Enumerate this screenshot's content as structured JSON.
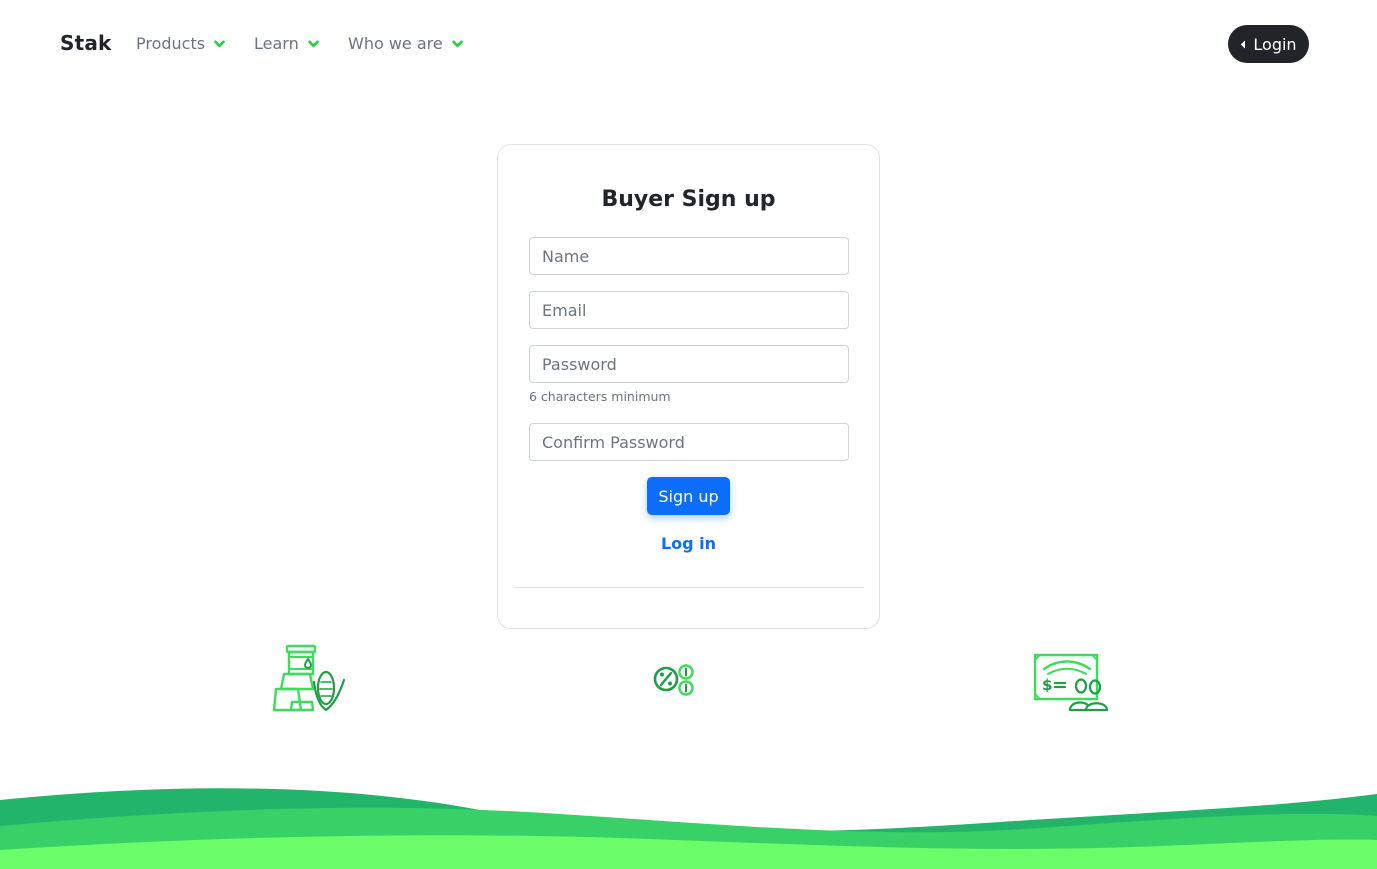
{
  "nav": {
    "brand": "Stak",
    "items": [
      {
        "label": "Products"
      },
      {
        "label": "Learn"
      },
      {
        "label": "Who we are"
      }
    ],
    "login_label": "Login"
  },
  "form": {
    "title": "Buyer Sign up",
    "name_placeholder": "Name",
    "email_placeholder": "Email",
    "password_placeholder": "Password",
    "password_hint": "6 characters minimum",
    "confirm_placeholder": "Confirm Password",
    "submit_label": "Sign up",
    "login_link": "Log in"
  },
  "icons": [
    "commodities-icon",
    "percent-exchange-icon",
    "payment-icon"
  ],
  "colors": {
    "accent_green": "#2ecc40",
    "primary_blue": "#0d6efd",
    "dark": "#212529",
    "wave_dark": "#22b46a",
    "wave_mid": "#38d168",
    "wave_light": "#6bfc6a"
  }
}
